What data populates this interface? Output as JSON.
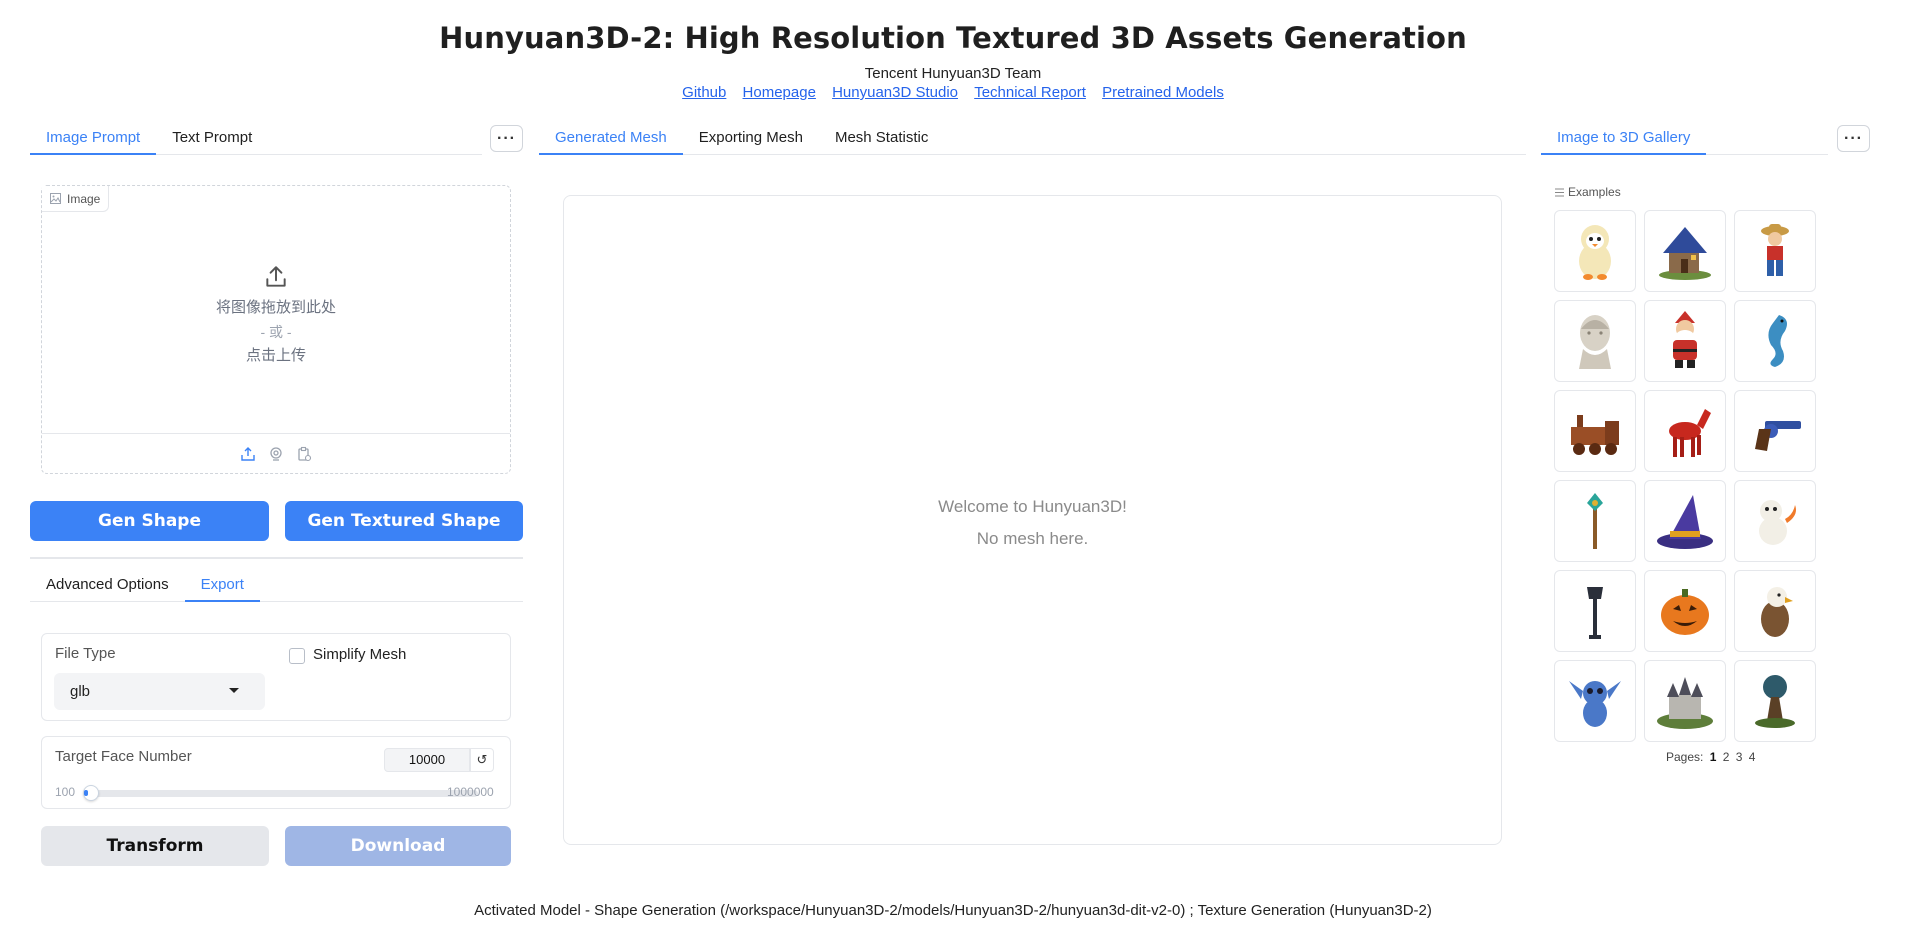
{
  "header": {
    "title": "Hunyuan3D-2: High Resolution Textured 3D Assets Generation",
    "team": "Tencent Hunyuan3D Team",
    "links": [
      "Github",
      "Homepage",
      "Hunyuan3D Studio",
      "Technical Report",
      "Pretrained Models"
    ]
  },
  "left": {
    "tabs": [
      "Image Prompt",
      "Text Prompt"
    ],
    "more": "···",
    "image": {
      "label": "Image",
      "drop_text": "将图像拖放到此处",
      "or_text": "- 或 -",
      "click_text": "点击上传"
    },
    "gen_shape": "Gen Shape",
    "gen_textured": "Gen Textured Shape",
    "option_tabs": [
      "Advanced Options",
      "Export"
    ],
    "export": {
      "file_type_label": "File Type",
      "file_type_value": "glb",
      "simplify_label": "Simplify Mesh",
      "face_label": "Target Face Number",
      "face_value": "10000",
      "face_min": "100",
      "face_max": "1000000",
      "face_level": 0.01,
      "reset": "↺"
    },
    "transform": "Transform",
    "download": "Download"
  },
  "center": {
    "tabs": [
      "Generated Mesh",
      "Exporting Mesh",
      "Mesh Statistic"
    ],
    "welcome": "Welcome to Hunyuan3D!",
    "no_mesh": "No mesh here."
  },
  "right": {
    "tab": "Image to 3D Gallery",
    "more": "···",
    "examples_label": "Examples",
    "examples": [
      "penguin-doll",
      "blue-house",
      "pirate-figure",
      "marble-bust",
      "santa-figure",
      "seahorse",
      "steam-train",
      "red-horse",
      "revolver",
      "magic-staff",
      "wizard-hat",
      "baby-dragon",
      "street-lamp",
      "pumpkin",
      "eagle",
      "stitch",
      "castle",
      "tree-globe"
    ],
    "pages_label": "Pages:",
    "pages": [
      "1",
      "2",
      "3",
      "4"
    ]
  },
  "footer": {
    "text": "Activated Model - Shape Generation (/workspace/Hunyuan3D-2/models/Hunyuan3D-2/hunyuan3d-dit-v2-0) ; Texture Generation (Hunyuan3D-2)"
  },
  "colors": {
    "accent": "#3b82f6",
    "disabled": "#9fb6e5",
    "secondary": "#e5e7eb"
  }
}
